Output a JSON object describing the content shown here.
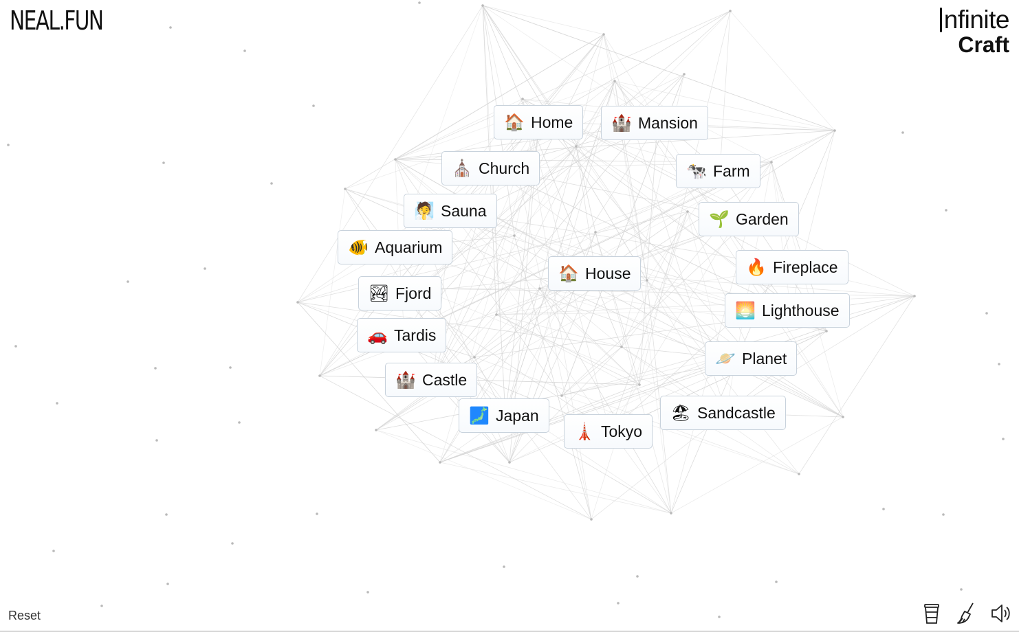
{
  "brand": {
    "left_logo": "NEAL.FUN",
    "right_logo_line1": "nfinite",
    "right_logo_line2": "Craft"
  },
  "items": [
    {
      "label": "Home",
      "icon": "house-with-garden-icon",
      "emoji": "🏠"
    },
    {
      "label": "Mansion",
      "icon": "castle-icon",
      "emoji": "🏰"
    },
    {
      "label": "Church",
      "icon": "church-icon",
      "emoji": "⛪"
    },
    {
      "label": "Farm",
      "icon": "cow-icon",
      "emoji": "🐄"
    },
    {
      "label": "Sauna",
      "icon": "person-in-steamy-room-icon",
      "emoji": "🧖"
    },
    {
      "label": "Garden",
      "icon": "seedling-icon",
      "emoji": "🌱"
    },
    {
      "label": "Aquarium",
      "icon": "tropical-fish-icon",
      "emoji": "🐠"
    },
    {
      "label": "House",
      "icon": "house-icon",
      "emoji": "🏠"
    },
    {
      "label": "Fireplace",
      "icon": "fire-icon",
      "emoji": "🔥"
    },
    {
      "label": "Fjord",
      "icon": "mountain-icon",
      "emoji": "🏞"
    },
    {
      "label": "Lighthouse",
      "icon": "sunrise-icon",
      "emoji": "🌅"
    },
    {
      "label": "Tardis",
      "icon": "car-icon",
      "emoji": "🚗"
    },
    {
      "label": "Planet",
      "icon": "ringed-planet-icon",
      "emoji": "🪐"
    },
    {
      "label": "Castle",
      "icon": "castle-icon",
      "emoji": "🏰"
    },
    {
      "label": "Sandcastle",
      "icon": "beach-umbrella-icon",
      "emoji": "🏖"
    },
    {
      "label": "Japan",
      "icon": "map-of-japan-icon",
      "emoji": "🗾"
    },
    {
      "label": "Tokyo",
      "icon": "tokyo-tower-icon",
      "emoji": "🗼"
    }
  ],
  "footer": {
    "reset_label": "Reset",
    "tools": [
      {
        "name": "coffee-cup-icon"
      },
      {
        "name": "broom-icon"
      },
      {
        "name": "speaker-icon"
      }
    ]
  }
}
